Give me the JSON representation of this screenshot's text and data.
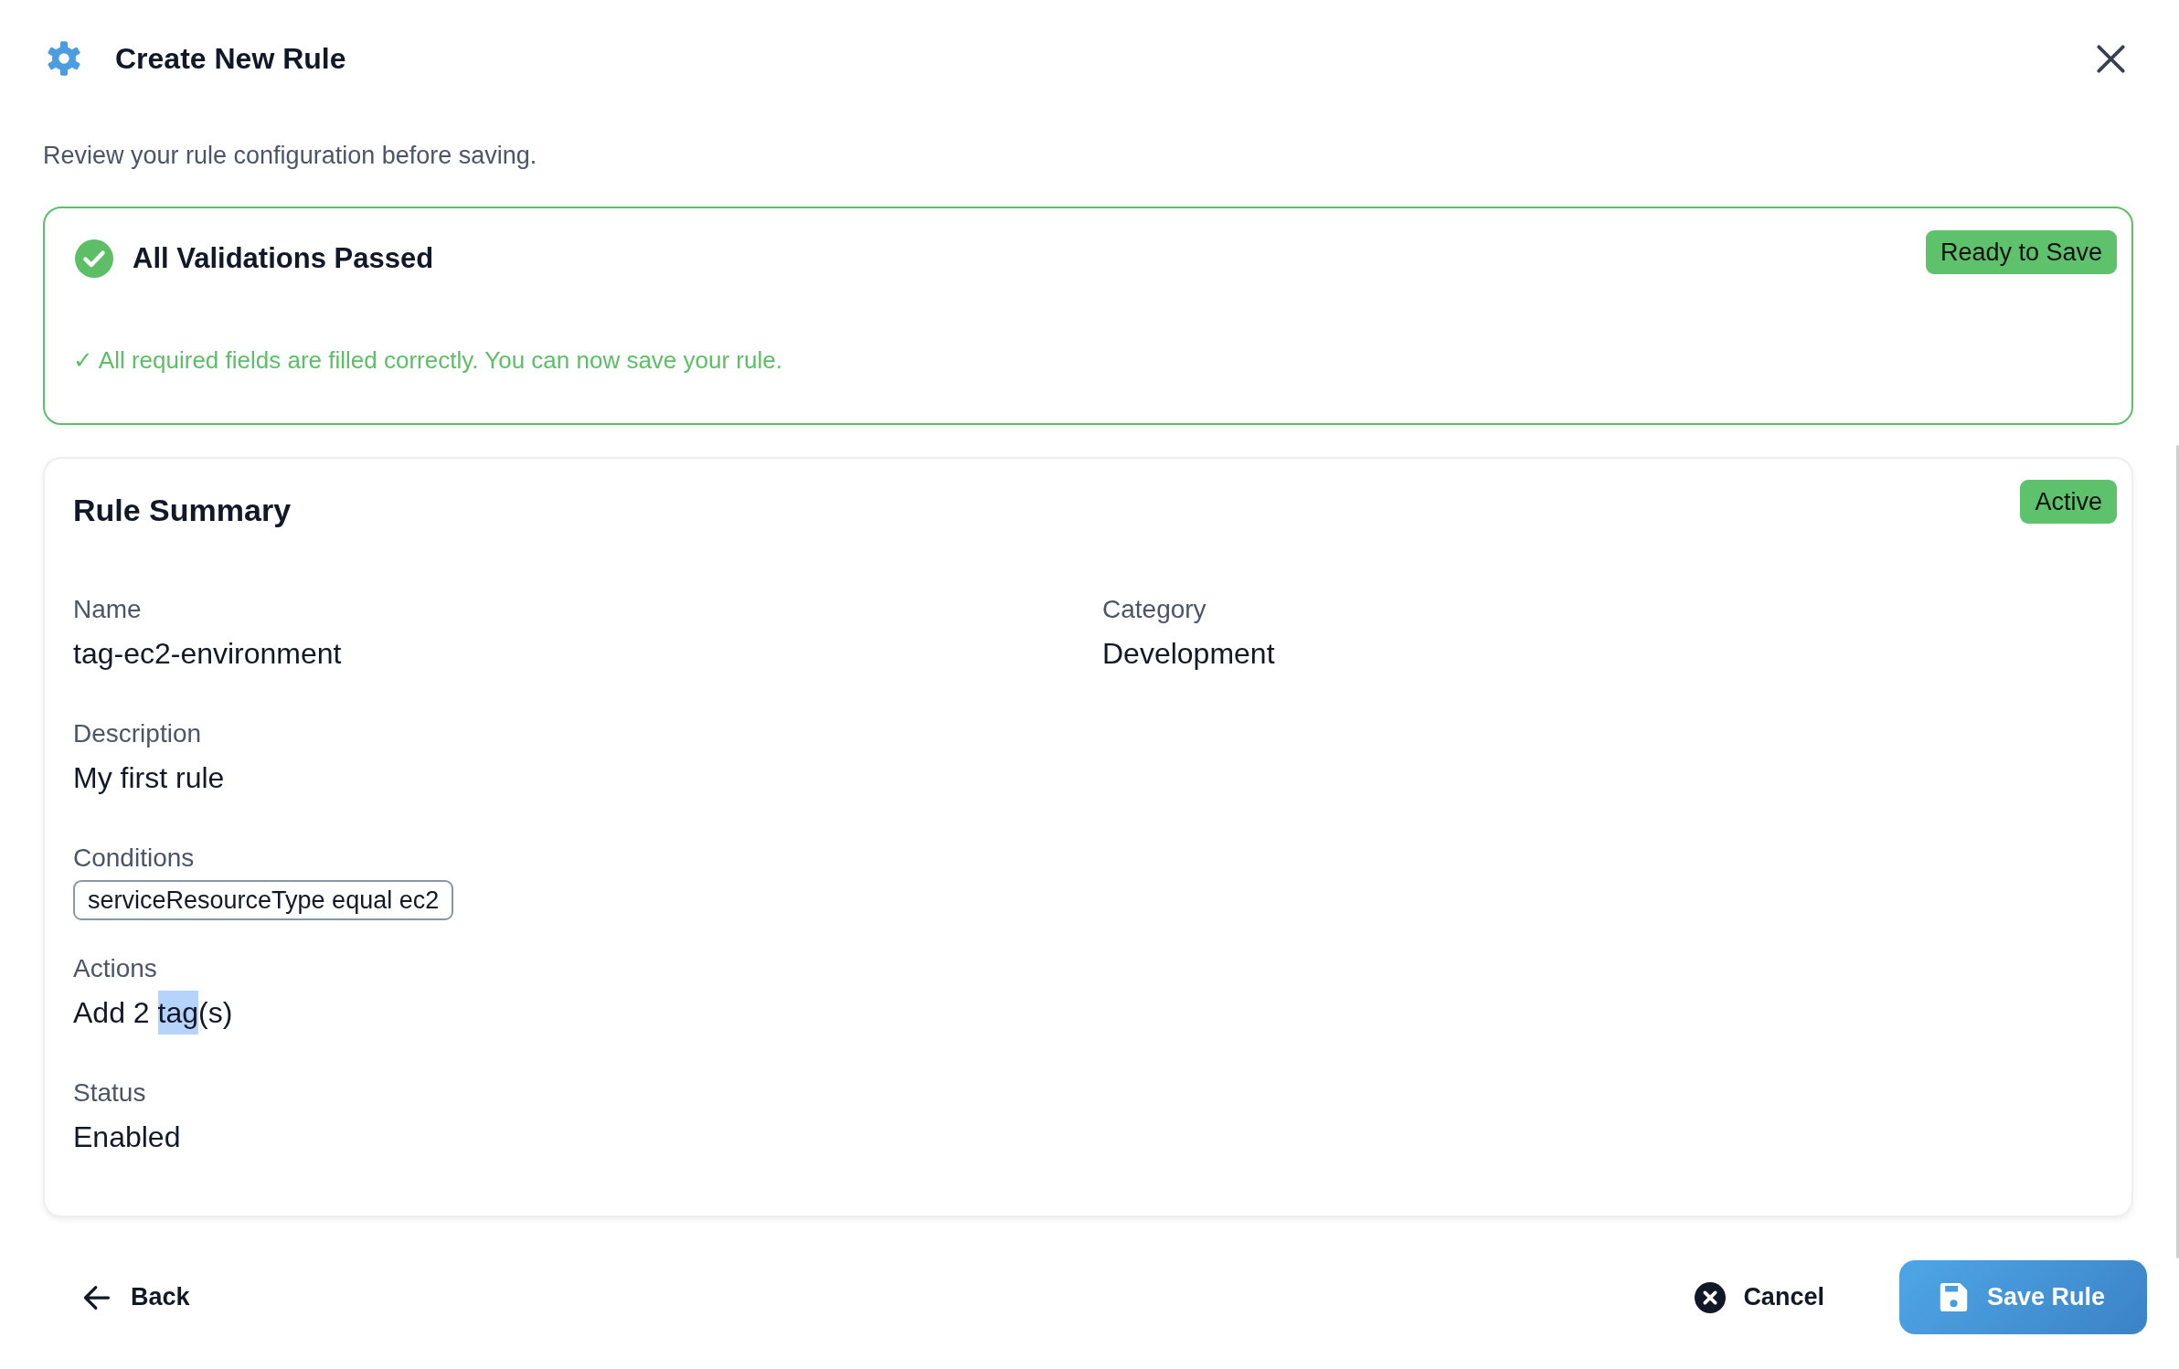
{
  "dialog": {
    "title": "Create New Rule",
    "subtitle": "Review your rule configuration before saving."
  },
  "validation": {
    "title": "All Validations Passed",
    "badge": "Ready to Save",
    "message": "✓ All required fields are filled correctly. You can now save your rule."
  },
  "summary": {
    "title": "Rule Summary",
    "badge": "Active",
    "rows": [
      [
        {
          "label": "Name",
          "kind": "text",
          "value": "tag-ec2-environment"
        },
        {
          "label": "Category",
          "kind": "text",
          "value": "Development"
        }
      ],
      [
        {
          "label": "Description",
          "kind": "text",
          "value": "My first rule"
        }
      ],
      [
        {
          "label": "Conditions",
          "kind": "chips",
          "chips": [
            "serviceResourceType equal ec2"
          ]
        }
      ],
      [
        {
          "label": "Actions",
          "kind": "parts",
          "value": [
            {
              "text": "Add 2 ",
              "selected": false
            },
            {
              "text": "tag",
              "selected": true
            },
            {
              "text": "(s)",
              "selected": false
            }
          ]
        }
      ],
      [
        {
          "label": "Status",
          "kind": "text",
          "value": "Enabled"
        }
      ]
    ]
  },
  "footer": {
    "back": "Back",
    "cancel": "Cancel",
    "save": "Save Rule"
  }
}
